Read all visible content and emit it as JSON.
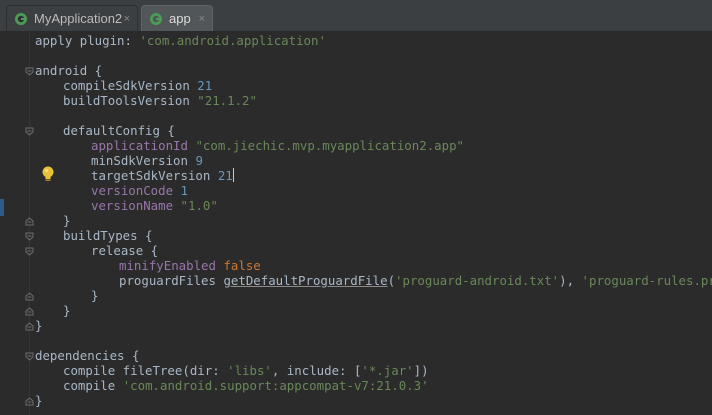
{
  "tabs": [
    {
      "label": "MyApplication2",
      "close": "×"
    },
    {
      "label": "app",
      "close": "×"
    }
  ],
  "icons": {
    "tab_icon": "gradle-project-icon",
    "intention": "lightbulb-icon",
    "fold": "fold-marker-icon"
  },
  "code": {
    "l1": {
      "a": "apply plugin: ",
      "b": "'com.android.application'"
    },
    "l3": "android {",
    "l4": {
      "a": "compileSdkVersion ",
      "b": "21"
    },
    "l5": {
      "a": "buildToolsVersion ",
      "b": "\"21.1.2\""
    },
    "l7": "defaultConfig {",
    "l8": {
      "a": "applicationId ",
      "b": "\"com.jiechic.mvp.myapplication2.app\""
    },
    "l9": {
      "a": "minSdkVersion ",
      "b": "9"
    },
    "l10": {
      "a": "targetSdkVersion ",
      "b": "21"
    },
    "l11": {
      "a": "versionCode ",
      "b": "1"
    },
    "l12": {
      "a": "versionName ",
      "b": "\"1.0\""
    },
    "l13": "}",
    "l14": "buildTypes {",
    "l15": "release {",
    "l16": {
      "a": "minifyEnabled ",
      "b": "false"
    },
    "l17": {
      "a": "proguardFiles ",
      "b": "getDefaultProguardFile",
      "c": "(",
      "d": "'proguard-android.txt'",
      "e": "), ",
      "f": "'proguard-rules.pro'"
    },
    "l18": "}",
    "l19": "}",
    "l20": "}",
    "l22": "dependencies {",
    "l23": {
      "a": "compile fileTree(dir: ",
      "b": "'libs'",
      "c": ", include: [",
      "d": "'*.jar'",
      "e": "])"
    },
    "l24": {
      "a": "compile ",
      "b": "'com.android.support:appcompat-v7:21.0.3'"
    },
    "l25": "}"
  },
  "colors": {
    "background": "#2b2b2b",
    "keyword": "#cc7832",
    "string": "#6a8759",
    "number": "#6897bb",
    "property": "#9876aa",
    "text": "#a9b7c6"
  }
}
